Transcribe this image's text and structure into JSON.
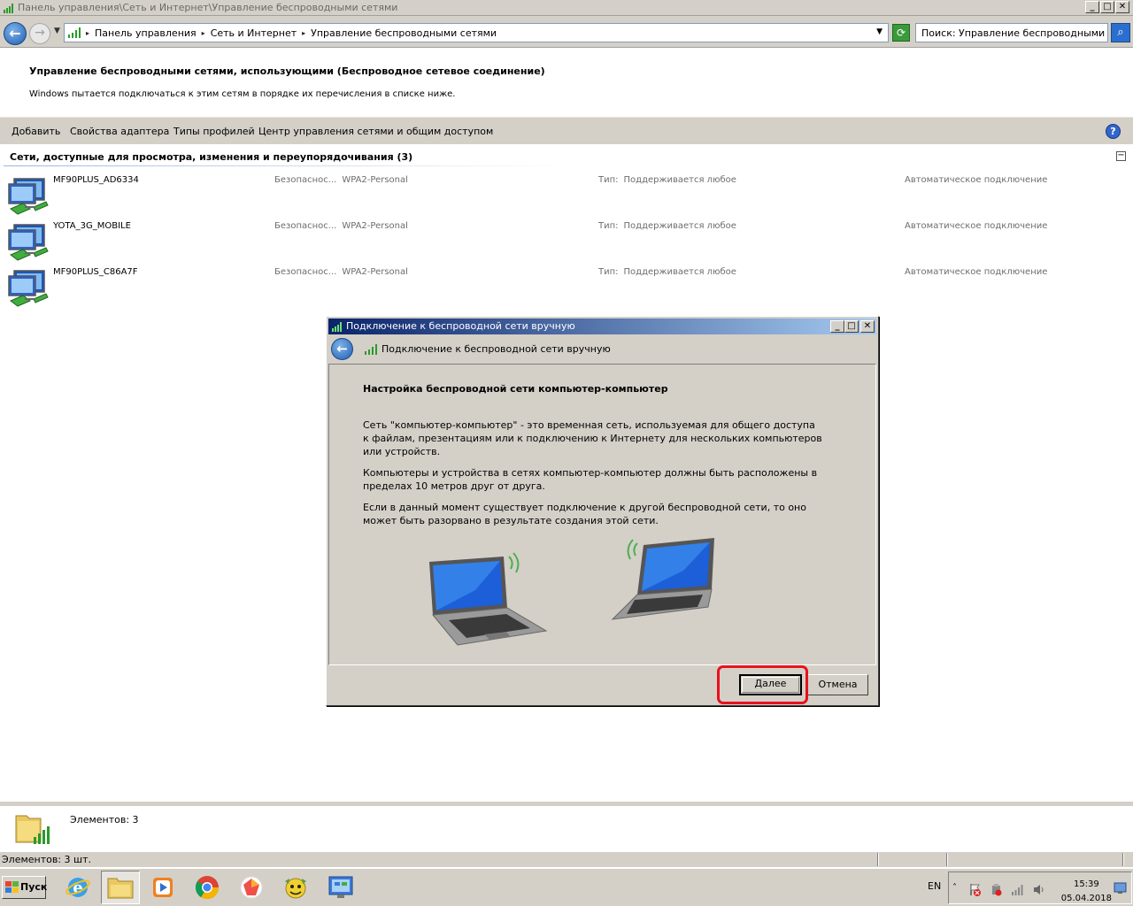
{
  "window": {
    "title": "Панель управления\\Сеть и Интернет\\Управление беспроводными сетями",
    "controls": [
      "_",
      "□",
      "✕"
    ]
  },
  "address": {
    "crumbs": [
      "Панель управления",
      "Сеть и Интернет",
      "Управление беспроводными сетями"
    ],
    "search_placeholder": "Поиск: Управление беспроводными ..."
  },
  "header": {
    "title": "Управление беспроводными сетями, использующими (Беспроводное сетевое соединение)",
    "subtitle": "Windows пытается подключаться к этим сетям в порядке их перечисления в списке ниже."
  },
  "toolbar": {
    "items": [
      "Добавить",
      "Свойства адаптера",
      "Типы профилей",
      "Центр управления сетями и общим доступом"
    ],
    "help": "?"
  },
  "group": {
    "title": "Сети, доступные для просмотра, изменения и переупорядочивания (3)",
    "collapse": "−"
  },
  "networks": [
    {
      "name": "MF90PLUS_AD6334",
      "sec_label": "Безопаснос...",
      "sec_value": "WPA2-Personal",
      "type_label": "Тип:",
      "type_value": "Поддерживается любое",
      "auto": "Автоматическое подключение"
    },
    {
      "name": "YOTA_3G_MOBILE",
      "sec_label": "Безопаснос...",
      "sec_value": "WPA2-Personal",
      "type_label": "Тип:",
      "type_value": "Поддерживается любое",
      "auto": "Автоматическое подключение"
    },
    {
      "name": "MF90PLUS_C86A7F",
      "sec_label": "Безопаснос...",
      "sec_value": "WPA2-Personal",
      "type_label": "Тип:",
      "type_value": "Поддерживается любое",
      "auto": "Автоматическое подключение"
    }
  ],
  "dialog": {
    "title": "Подключение к беспроводной сети вручную",
    "nav_title": "Подключение к беспроводной сети вручную",
    "heading": "Настройка беспроводной сети компьютер-компьютер",
    "para1": "Сеть \"компьютер-компьютер\" - это временная сеть, используемая для общего доступа к файлам, презентациям или к подключению к Интернету для нескольких компьютеров или устройств.",
    "para2": "Компьютеры и устройства в сетях компьютер-компьютер должны быть расположены в пределах 10 метров друг от друга.",
    "para3": "Если в данный момент существует подключение к другой беспроводной сети, то оно может быть разорвано в результате создания этой сети.",
    "next": "Далее",
    "cancel": "Отмена",
    "highlight_color": "#e8101e"
  },
  "details": {
    "count_text": "Элементов: 3"
  },
  "statusbar": {
    "text": "Элементов: 3 шт."
  },
  "taskbar": {
    "start": "Пуск",
    "apps": [
      "ie-icon",
      "explorer-icon",
      "media-player-icon",
      "chrome-icon",
      "app-icon",
      "game-icon",
      "control-panel-icon"
    ],
    "lang": "EN",
    "time": "15:39",
    "date": "05.04.2018"
  }
}
